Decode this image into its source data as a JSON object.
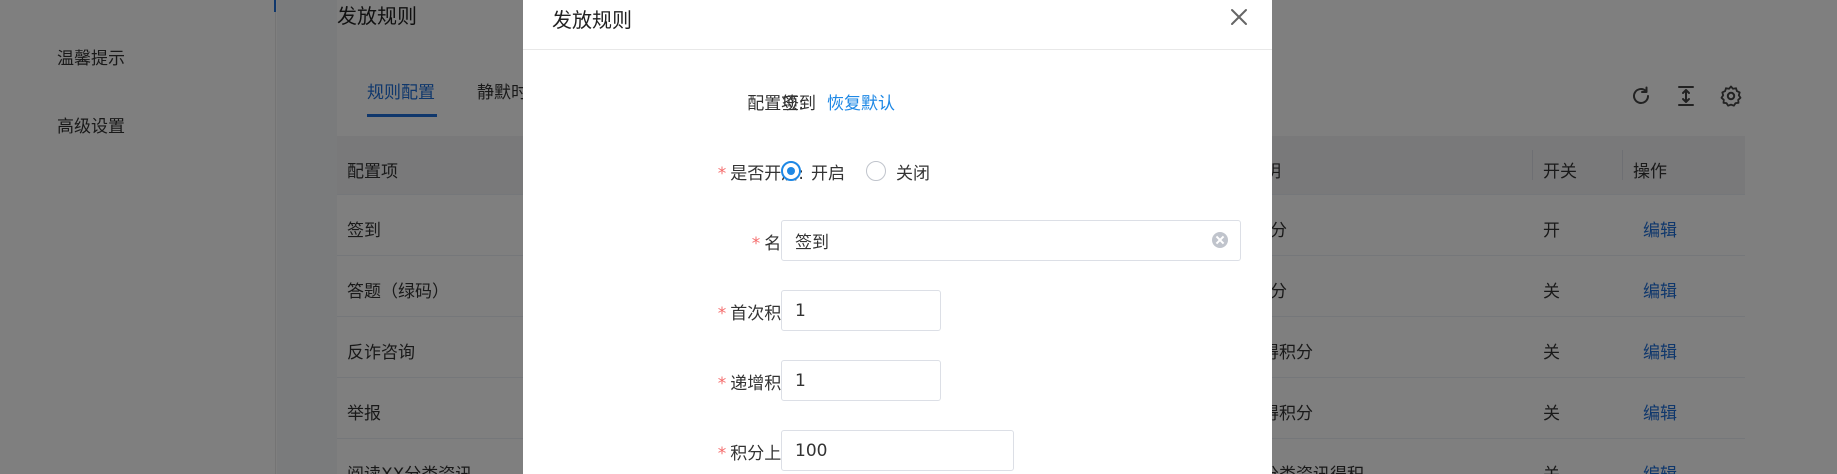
{
  "sidebar": {
    "items": [
      {
        "label": "温馨提示"
      },
      {
        "label": "高级设置"
      }
    ]
  },
  "page": {
    "title": "发放规则",
    "tabs": [
      {
        "label": "规则配置",
        "active": true
      },
      {
        "label": "静默时"
      }
    ],
    "toolbar": {
      "icons": [
        "refresh-icon",
        "column-height-icon",
        "settings-icon"
      ]
    }
  },
  "table": {
    "headers": {
      "config_item": "配置项",
      "desc": "明",
      "switch": "开关",
      "action": "操作"
    },
    "rows": [
      {
        "name": "签到",
        "desc": "分",
        "switch": "开",
        "action": "编辑"
      },
      {
        "name": "答题（绿码）",
        "desc": "分",
        "switch": "关",
        "action": "编辑"
      },
      {
        "name": "反诈咨询",
        "desc": "得积分",
        "switch": "关",
        "action": "编辑"
      },
      {
        "name": "举报",
        "desc": "得积分",
        "switch": "关",
        "action": "编辑"
      },
      {
        "name": "阅读XX分类资讯",
        "desc": "分类资讯得积",
        "switch": "关",
        "action": "编辑"
      }
    ]
  },
  "modal": {
    "title": "发放规则",
    "config_item_label": "配置项:",
    "config_item_value": "签到",
    "restore_default": "恢复默认",
    "enabled_label": "是否开启:",
    "radio_on": "开启",
    "radio_off": "关闭",
    "enabled_value": "开启",
    "name_label": "名称:",
    "name_value": "签到",
    "first_points_label": "首次积分:",
    "first_points_value": "1",
    "increment_points_label": "递增积分:",
    "increment_points_value": "1",
    "points_limit_label": "积分上限:",
    "points_limit_value": "100",
    "required_mark": "*"
  },
  "colors": {
    "primary": "#1e6fd9",
    "link": "#1e88e5",
    "required": "#f56c6c",
    "overlay": "rgba(0,0,0,0.5)"
  }
}
